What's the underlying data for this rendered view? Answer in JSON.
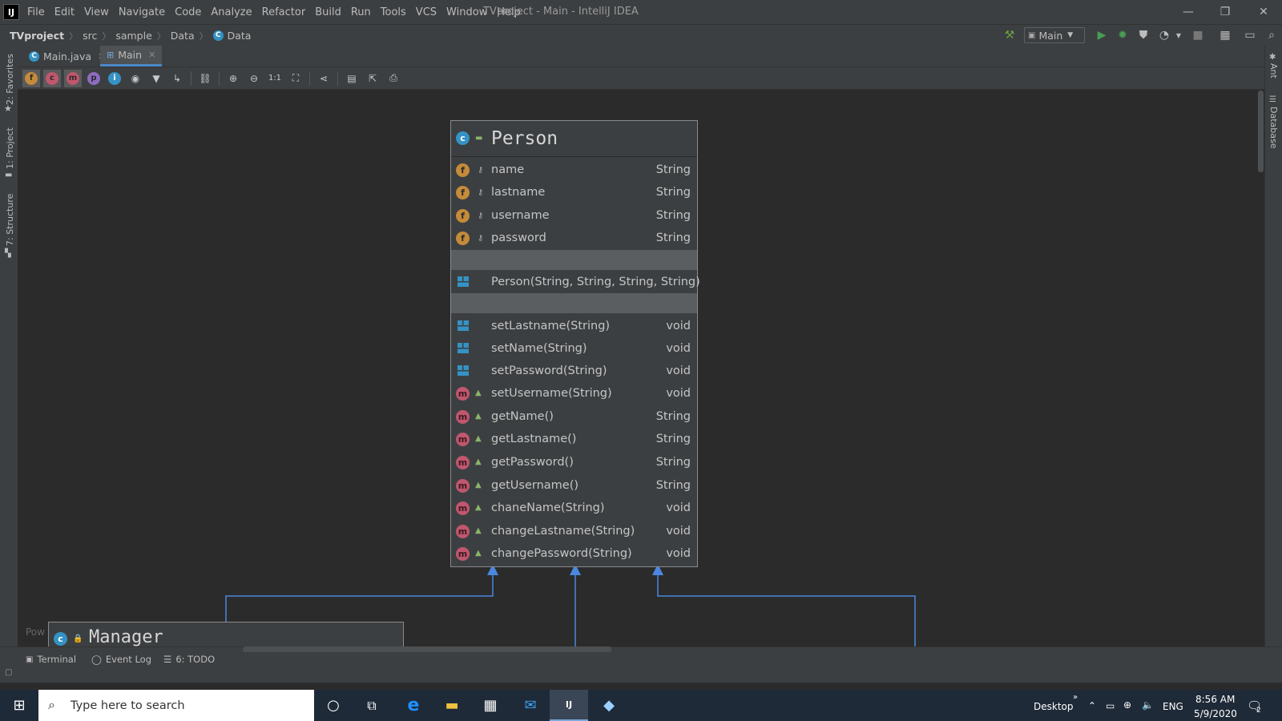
{
  "window": {
    "title": "TVproject - Main - IntelliJ IDEA",
    "app_logo": "IJ",
    "controls": {
      "minimize": "—",
      "restore": "❐",
      "close": "✕"
    }
  },
  "menu": [
    "File",
    "Edit",
    "View",
    "Navigate",
    "Code",
    "Analyze",
    "Refactor",
    "Build",
    "Run",
    "Tools",
    "VCS",
    "Window",
    "Help"
  ],
  "breadcrumb": {
    "project": "TVproject",
    "parts": [
      "src",
      "sample",
      "Data"
    ],
    "current": "Data"
  },
  "run_config": {
    "label": "Main"
  },
  "tabs": [
    {
      "label": "Main.java",
      "icon": "class-icon",
      "active": false
    },
    {
      "label": "Main",
      "icon": "diagram-icon",
      "active": true
    }
  ],
  "diagram_toolbar": {
    "icons": [
      "fields-icon",
      "constructors-icon",
      "methods-icon",
      "properties-icon",
      "inner-classes-icon",
      "visibility-icon",
      "filter-icon",
      "dependencies-icon",
      "link-icon",
      "zoom-in-icon",
      "zoom-out-icon",
      "actual-size-icon",
      "fit-content-icon",
      "layout-icon",
      "save-icon",
      "export-icon",
      "print-icon"
    ],
    "actual_size_label": "1:1"
  },
  "left_strip": [
    "2: Favorites",
    "1: Project",
    "7: Structure"
  ],
  "right_strip": [
    "Ant",
    "Database"
  ],
  "diagram": {
    "person": {
      "title": "Person",
      "fields": [
        {
          "name": "name",
          "type": "String"
        },
        {
          "name": "lastname",
          "type": "String"
        },
        {
          "name": "username",
          "type": "String"
        },
        {
          "name": "password",
          "type": "String"
        }
      ],
      "constructors": [
        {
          "name": "Person(String, String, String, String)",
          "type": ""
        }
      ],
      "methods": [
        {
          "name": "setLastname(String)",
          "type": "void",
          "kind": "ctor-like"
        },
        {
          "name": "setName(String)",
          "type": "void",
          "kind": "ctor-like"
        },
        {
          "name": "setPassword(String)",
          "type": "void",
          "kind": "ctor-like"
        },
        {
          "name": "setUsername(String)",
          "type": "void",
          "kind": "method"
        },
        {
          "name": "getName()",
          "type": "String",
          "kind": "method"
        },
        {
          "name": "getLastname()",
          "type": "String",
          "kind": "method"
        },
        {
          "name": "getPassword()",
          "type": "String",
          "kind": "method"
        },
        {
          "name": "getUsername()",
          "type": "String",
          "kind": "method"
        },
        {
          "name": "chaneName(String)",
          "type": "void",
          "kind": "method"
        },
        {
          "name": "changeLastname(String)",
          "type": "void",
          "kind": "method"
        },
        {
          "name": "changePassword(String)",
          "type": "void",
          "kind": "method"
        }
      ]
    },
    "manager": {
      "title": "Manager"
    },
    "powered_label": "Pow"
  },
  "bottom_tools": [
    {
      "label": "Terminal",
      "icon": "terminal-icon"
    },
    {
      "label": "Event Log",
      "icon": "event-log-icon"
    },
    {
      "label": "6: TODO",
      "icon": "todo-icon"
    }
  ],
  "taskbar": {
    "search_placeholder": "Type here to search",
    "desktop_label": "Desktop",
    "language": "ENG",
    "time": "8:56 AM",
    "date": "5/9/2020",
    "notifications": "2"
  },
  "colors": {
    "accent": "#4a88c7",
    "field": "#c48b3b",
    "method": "#c0576e",
    "class": "#3592c4",
    "run": "#499c54",
    "arrow": "#4a88e0"
  }
}
